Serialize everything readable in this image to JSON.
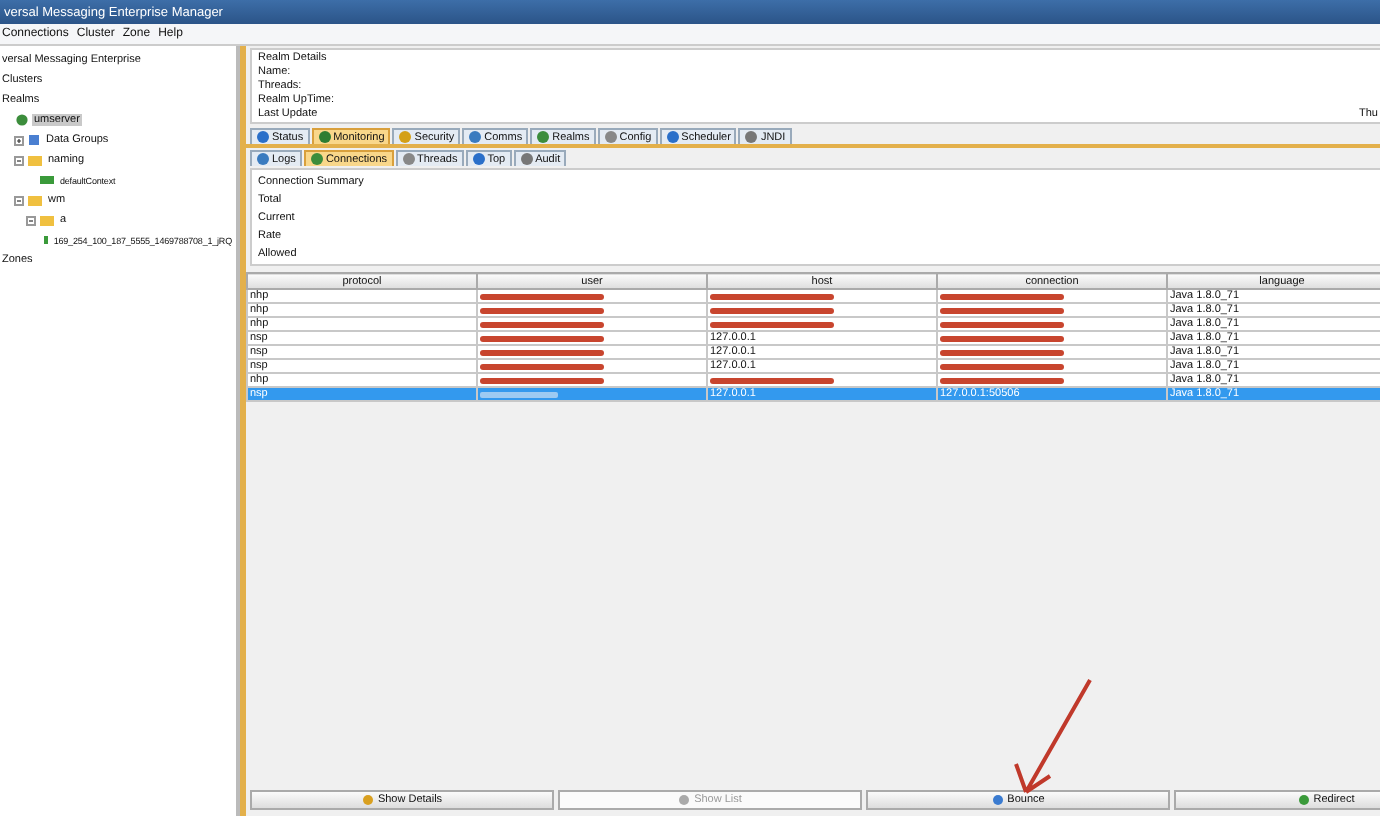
{
  "window": {
    "title": "versal Messaging Enterprise Manager"
  },
  "menu": [
    "Connections",
    "Cluster",
    "Zone",
    "Help"
  ],
  "sidebar": {
    "header": "versal Messaging Enterprise",
    "sections": [
      {
        "label": "Clusters"
      },
      {
        "label": "Realms"
      }
    ],
    "tree": [
      {
        "label": "umserver",
        "kind": "realm",
        "selected": true,
        "children": [
          {
            "label": "Data Groups",
            "kind": "group",
            "selected": false,
            "expanded": false
          },
          {
            "label": "naming",
            "kind": "folder",
            "selected": false,
            "expanded": true,
            "children": [
              {
                "label": "defaultContext",
                "kind": "leaf",
                "selected": false
              }
            ]
          },
          {
            "label": "wm",
            "kind": "folder",
            "selected": false,
            "expanded": true,
            "children": [
              {
                "label": "a",
                "kind": "folder",
                "selected": false,
                "expanded": true,
                "children": [
                  {
                    "label": "169_254_100_187_5555_1469788708_1_jRQ",
                    "kind": "leaf",
                    "selected": false
                  }
                ]
              }
            ]
          }
        ]
      }
    ],
    "footer": "Zones"
  },
  "realm_details": {
    "title": "Realm Details",
    "fields": [
      "Name:",
      "Threads:",
      "Realm UpTime:",
      "Last Update"
    ],
    "last_update_value": "Thu"
  },
  "tabs": [
    {
      "label": "Status",
      "selected": false
    },
    {
      "label": "Monitoring",
      "selected": true
    },
    {
      "label": "Security",
      "selected": false
    },
    {
      "label": "Comms",
      "selected": false
    },
    {
      "label": "Realms",
      "selected": false
    },
    {
      "label": "Config",
      "selected": false
    },
    {
      "label": "Scheduler",
      "selected": false
    },
    {
      "label": "JNDI",
      "selected": false
    }
  ],
  "subtabs": [
    {
      "label": "Logs",
      "selected": false
    },
    {
      "label": "Connections",
      "selected": true
    },
    {
      "label": "Threads",
      "selected": false
    },
    {
      "label": "Top",
      "selected": false
    },
    {
      "label": "Audit",
      "selected": false
    }
  ],
  "connection_summary": {
    "title": "Connection Summary",
    "fields": [
      "Total",
      "Current",
      "Rate",
      "Allowed"
    ]
  },
  "table": {
    "columns": [
      "protocol",
      "user",
      "host",
      "connection",
      "language"
    ],
    "rows": [
      {
        "selected": false,
        "cells": [
          {
            "kind": "text",
            "text": "nhp"
          },
          {
            "kind": "redacted"
          },
          {
            "kind": "redacted"
          },
          {
            "kind": "redacted"
          },
          {
            "kind": "text",
            "text": "Java 1.8.0_71"
          }
        ]
      },
      {
        "selected": false,
        "cells": [
          {
            "kind": "text",
            "text": "nhp"
          },
          {
            "kind": "redacted"
          },
          {
            "kind": "redacted"
          },
          {
            "kind": "redacted"
          },
          {
            "kind": "text",
            "text": "Java 1.8.0_71"
          }
        ]
      },
      {
        "selected": false,
        "cells": [
          {
            "kind": "text",
            "text": "nhp"
          },
          {
            "kind": "redacted"
          },
          {
            "kind": "redacted"
          },
          {
            "kind": "redacted"
          },
          {
            "kind": "text",
            "text": "Java 1.8.0_71"
          }
        ]
      },
      {
        "selected": false,
        "cells": [
          {
            "kind": "text",
            "text": "nsp"
          },
          {
            "kind": "redacted"
          },
          {
            "kind": "text",
            "text": "127.0.0.1"
          },
          {
            "kind": "redacted"
          },
          {
            "kind": "text",
            "text": "Java 1.8.0_71"
          }
        ]
      },
      {
        "selected": false,
        "cells": [
          {
            "kind": "text",
            "text": "nsp"
          },
          {
            "kind": "redacted"
          },
          {
            "kind": "text",
            "text": "127.0.0.1"
          },
          {
            "kind": "redacted"
          },
          {
            "kind": "text",
            "text": "Java 1.8.0_71"
          }
        ]
      },
      {
        "selected": false,
        "cells": [
          {
            "kind": "text",
            "text": "nsp"
          },
          {
            "kind": "redacted"
          },
          {
            "kind": "text",
            "text": "127.0.0.1"
          },
          {
            "kind": "redacted"
          },
          {
            "kind": "text",
            "text": "Java 1.8.0_71"
          }
        ]
      },
      {
        "selected": false,
        "cells": [
          {
            "kind": "text",
            "text": "nhp"
          },
          {
            "kind": "redacted"
          },
          {
            "kind": "redacted"
          },
          {
            "kind": "redacted"
          },
          {
            "kind": "text",
            "text": "Java 1.8.0_71"
          }
        ]
      },
      {
        "selected": true,
        "cells": [
          {
            "kind": "text",
            "text": "nsp"
          },
          {
            "kind": "illegible"
          },
          {
            "kind": "text",
            "text": "127.0.0.1"
          },
          {
            "kind": "text",
            "text": "127.0.0.1:50506"
          },
          {
            "kind": "text",
            "text": "Java 1.8.0_71"
          }
        ]
      }
    ]
  },
  "buttons": [
    {
      "label": "Show Details",
      "disabled": false
    },
    {
      "label": "Show List",
      "disabled": true
    },
    {
      "label": "Bounce",
      "disabled": false
    },
    {
      "label": "Redirect",
      "disabled": false
    }
  ]
}
